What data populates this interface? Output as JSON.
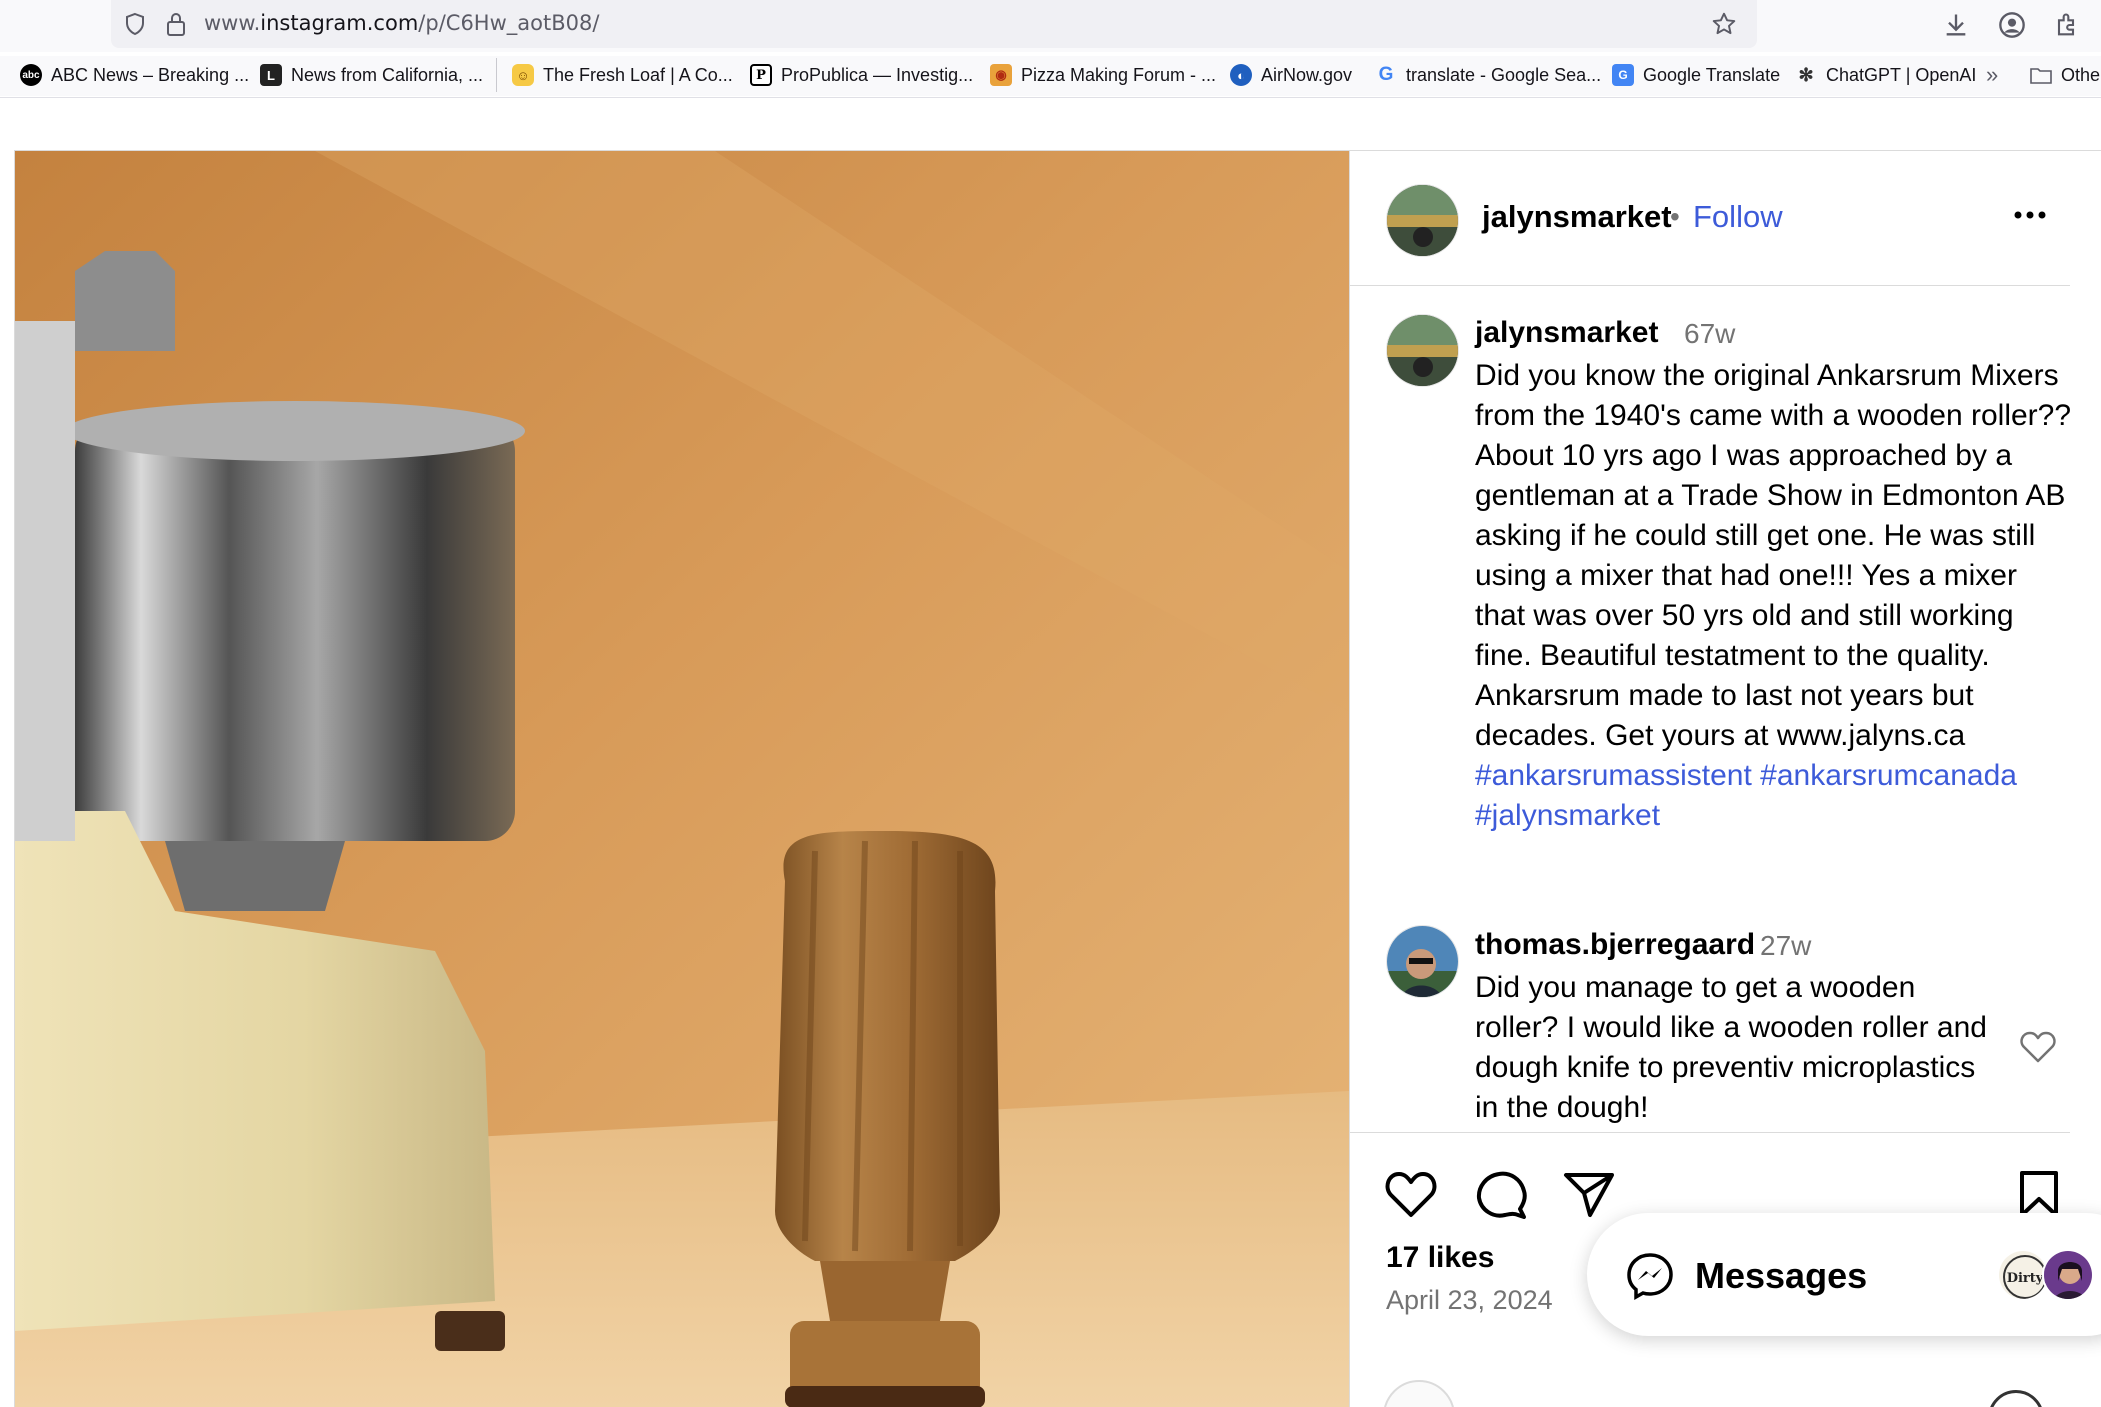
{
  "browser": {
    "url_prefix": "www.",
    "url_domain": "instagram.com",
    "url_path": "/p/C6Hw_aotB08/",
    "bookmarks": [
      {
        "label": "ABC News – Breaking ...",
        "icon": "abc-icon"
      },
      {
        "label": "News from California, ...",
        "icon": "news-icon"
      },
      {
        "label": "The Fresh Loaf | A Co...",
        "icon": "freshloaf-icon"
      },
      {
        "label": "ProPublica — Investig...",
        "icon": "propublica-icon"
      },
      {
        "label": "Pizza Making Forum - ...",
        "icon": "pizza-icon"
      },
      {
        "label": "AirNow.gov",
        "icon": "airnow-icon"
      },
      {
        "label": "translate - Google Sea...",
        "icon": "google-icon"
      },
      {
        "label": "Google Translate",
        "icon": "translate-icon"
      },
      {
        "label": "ChatGPT | OpenAI",
        "icon": "openai-icon"
      },
      {
        "label": "Othe",
        "icon": "folder-icon"
      }
    ]
  },
  "post": {
    "header": {
      "username": "jalynsmarket",
      "dot": "•",
      "follow": "Follow"
    },
    "caption": {
      "username": "jalynsmarket",
      "time": "67w",
      "text": "Did you know the original Ankarsrum Mixers from the 1940's came with a wooden roller?? About 10 yrs ago I was approached by a gentleman at a Trade Show in Edmonton AB asking if he could still get one. He was still using a mixer that had one!!! Yes a mixer that was over 50 yrs old and still working fine. Beautiful testatment to the quality. Ankarsrum made to last not years but decades. Get yours at www.jalyns.ca",
      "hashtags": [
        "#ankarsrumassistent",
        "#ankarsrumcanada",
        "#jalynsmarket"
      ]
    },
    "comment": {
      "username": "thomas.bjerregaard",
      "time": "27w",
      "text": "Did you manage to get a wooden roller? I would like a wooden roller and dough knife to preventiv microplastics in the dough!"
    },
    "likes": "17 likes",
    "date": "April 23, 2024"
  },
  "messages": {
    "label": "Messages"
  },
  "colors": {
    "link_blue": "#3d5bd9",
    "secondary_text": "#737373",
    "border": "#dbdbdb"
  }
}
